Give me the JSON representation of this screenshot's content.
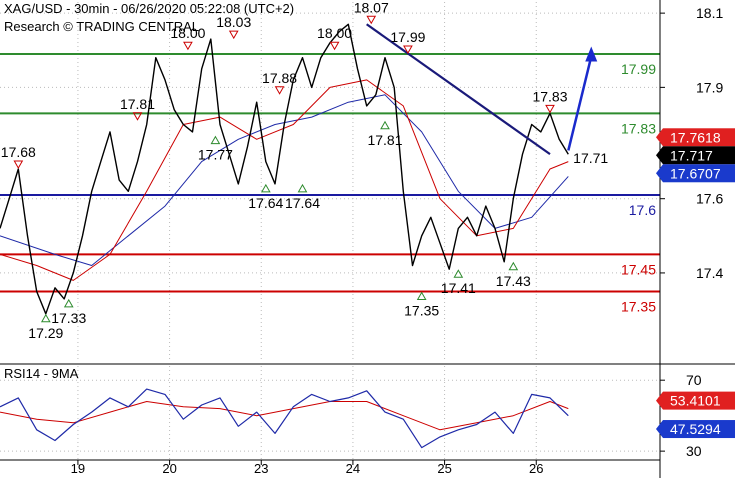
{
  "header": {
    "title": "XAG/USD - 30min - 06/26/2020 05:22:08 (UTC+2)",
    "subtitle": "Research © TRADING CENTRAL"
  },
  "colors": {
    "price": "#000000",
    "ma_fast": "#cc0000",
    "ma_slow": "#1f2aa8",
    "support_resistance_green": "#2e8b2e",
    "pivot_blue": "#1a1aa0",
    "support_red": "#cc0000",
    "trendline": "#1a1a7a",
    "arrow": "#1a2acc",
    "grid": "#bbbbbb",
    "badge_red": "#e02020",
    "badge_black": "#000000",
    "badge_blue": "#1a3acc"
  },
  "chart_data": [
    {
      "type": "line",
      "title": "XAG/USD - 30min - 06/26/2020 05:22:08 (UTC+2)",
      "ylim": [
        17.16,
        18.13
      ],
      "y_ticks": [
        "18.1",
        "17.9",
        "17.6",
        "17.4"
      ],
      "y_tick_values": [
        18.1,
        17.9,
        17.6,
        17.4
      ],
      "x_ticks": [
        "19",
        "20",
        "23",
        "24",
        "25",
        "26"
      ],
      "x_tick_positions": [
        8.5,
        18.5,
        28.5,
        38.5,
        48.5,
        58.5
      ],
      "x_range": [
        0,
        72
      ],
      "price_series": {
        "name": "",
        "x": [
          0,
          1,
          2,
          3,
          4,
          5,
          6,
          7,
          8,
          9,
          10,
          11,
          12,
          13,
          14,
          15,
          16,
          17,
          18,
          19,
          20,
          21,
          22,
          23,
          24,
          25,
          26,
          27,
          28,
          29,
          30,
          31,
          32,
          33,
          34,
          35,
          36,
          37,
          38,
          39,
          40,
          41,
          42,
          43,
          44,
          45,
          46,
          47,
          48,
          49,
          50,
          51,
          52,
          53,
          54,
          55,
          56,
          57,
          58,
          59,
          60,
          61,
          62
        ],
        "y": [
          17.52,
          17.6,
          17.68,
          17.5,
          17.35,
          17.29,
          17.36,
          17.33,
          17.4,
          17.5,
          17.62,
          17.7,
          17.78,
          17.65,
          17.62,
          17.7,
          17.8,
          17.98,
          17.92,
          17.84,
          17.8,
          17.78,
          17.95,
          18.03,
          17.8,
          17.72,
          17.64,
          17.74,
          17.86,
          17.7,
          17.64,
          17.8,
          17.92,
          17.98,
          17.9,
          17.98,
          18.02,
          18.05,
          18.07,
          17.95,
          17.85,
          17.88,
          17.98,
          17.9,
          17.62,
          17.42,
          17.5,
          17.55,
          17.48,
          17.41,
          17.52,
          17.55,
          17.5,
          17.58,
          17.52,
          17.43,
          17.6,
          17.72,
          17.8,
          17.78,
          17.83,
          17.76,
          17.72
        ]
      },
      "ma_fast_series": {
        "name": "",
        "x": [
          0,
          4,
          8,
          12,
          16,
          20,
          24,
          28,
          32,
          36,
          40,
          44,
          48,
          52,
          56,
          60,
          62
        ],
        "y": [
          17.45,
          17.42,
          17.38,
          17.45,
          17.62,
          17.8,
          17.82,
          17.76,
          17.8,
          17.9,
          17.92,
          17.85,
          17.6,
          17.5,
          17.52,
          17.68,
          17.7
        ]
      },
      "ma_slow_series": {
        "name": "",
        "x": [
          0,
          6,
          10,
          14,
          18,
          22,
          26,
          30,
          34,
          38,
          42,
          46,
          50,
          54,
          58,
          62
        ],
        "y": [
          17.5,
          17.45,
          17.42,
          17.5,
          17.58,
          17.7,
          17.76,
          17.8,
          17.82,
          17.86,
          17.88,
          17.78,
          17.62,
          17.52,
          17.55,
          17.66
        ]
      },
      "horizontal_levels": [
        {
          "label": "17.99",
          "value": 17.99,
          "color": "#2e8b2e"
        },
        {
          "label": "17.83",
          "value": 17.83,
          "color": "#2e8b2e"
        },
        {
          "label": "17.6",
          "value": 17.61,
          "color": "#1a1aa0"
        },
        {
          "label": "17.45",
          "value": 17.45,
          "color": "#cc0000"
        },
        {
          "label": "17.35",
          "value": 17.35,
          "color": "#cc0000"
        }
      ],
      "trendline": {
        "x1": 40,
        "y1": 18.07,
        "x2": 60,
        "y2": 17.72
      },
      "forecast_arrow": {
        "x1": 62,
        "y1": 17.73,
        "x2": 64.5,
        "y2": 18.01
      },
      "price_badges": [
        {
          "label": "17.7618",
          "value": 17.7618,
          "color": "#e02020"
        },
        {
          "label": "17.717",
          "value": 17.717,
          "color": "#000000"
        },
        {
          "label": "17.6707",
          "value": 17.6707,
          "color": "#1a3acc"
        }
      ],
      "annotations": [
        {
          "label": "17.68",
          "x": 2,
          "value": 17.68,
          "marker": "down"
        },
        {
          "label": "17.29",
          "x": 5,
          "value": 17.29,
          "marker": "up"
        },
        {
          "label": "17.33",
          "x": 7.5,
          "value": 17.33,
          "marker": "up"
        },
        {
          "label": "17.81",
          "x": 15,
          "value": 17.81,
          "marker": "down"
        },
        {
          "label": "18.00",
          "x": 20.5,
          "value": 18.0,
          "marker": "down"
        },
        {
          "label": "18.03",
          "x": 25.5,
          "value": 18.03,
          "marker": "down"
        },
        {
          "label": "17.77",
          "x": 23.5,
          "value": 17.77,
          "marker": "up"
        },
        {
          "label": "17.64",
          "x": 29,
          "value": 17.64,
          "marker": "up"
        },
        {
          "label": "17.64",
          "x": 33,
          "value": 17.64,
          "marker": "up"
        },
        {
          "label": "17.88",
          "x": 30.5,
          "value": 17.88,
          "marker": "down"
        },
        {
          "label": "18.00",
          "x": 36.5,
          "value": 18.0,
          "marker": "down"
        },
        {
          "label": "18.07",
          "x": 40.5,
          "value": 18.07,
          "marker": "down"
        },
        {
          "label": "17.99",
          "x": 44.5,
          "value": 17.99,
          "marker": "down"
        },
        {
          "label": "17.81",
          "x": 42,
          "value": 17.81,
          "marker": "up"
        },
        {
          "label": "17.35",
          "x": 46,
          "value": 17.35,
          "marker": "up"
        },
        {
          "label": "17.41",
          "x": 50,
          "value": 17.41,
          "marker": "up"
        },
        {
          "label": "17.43",
          "x": 56,
          "value": 17.43,
          "marker": "up"
        },
        {
          "label": "17.83",
          "x": 60,
          "value": 17.83,
          "marker": "down"
        },
        {
          "label": "17.71",
          "x": 61,
          "value": 17.71,
          "marker": "none"
        }
      ]
    },
    {
      "type": "line",
      "title": "RSI14 - 9MA",
      "ylim": [
        25,
        78
      ],
      "y_ticks": [
        "70",
        "30"
      ],
      "y_tick_values": [
        70,
        30
      ],
      "x_range": [
        0,
        72
      ],
      "rsi_series": {
        "name": "",
        "x": [
          0,
          2,
          4,
          6,
          8,
          10,
          12,
          14,
          16,
          18,
          20,
          22,
          24,
          26,
          28,
          30,
          32,
          34,
          36,
          38,
          40,
          42,
          44,
          46,
          48,
          50,
          52,
          54,
          56,
          58,
          60,
          62
        ],
        "y": [
          55,
          60,
          42,
          36,
          45,
          52,
          60,
          55,
          65,
          62,
          48,
          56,
          60,
          44,
          52,
          40,
          55,
          62,
          58,
          60,
          64,
          52,
          48,
          32,
          38,
          42,
          45,
          52,
          40,
          62,
          60,
          50
        ]
      },
      "rsi_ma_series": {
        "name": "",
        "x": [
          0,
          4,
          8,
          12,
          16,
          20,
          24,
          28,
          32,
          36,
          40,
          44,
          48,
          52,
          56,
          60,
          62
        ],
        "y": [
          52,
          48,
          46,
          52,
          58,
          55,
          54,
          50,
          54,
          58,
          58,
          50,
          42,
          46,
          50,
          58,
          54
        ]
      },
      "rsi_badges": [
        {
          "label": "53.4101",
          "value": 53.4101,
          "color": "#e02020"
        },
        {
          "label": "47.5294",
          "value": 47.5294,
          "color": "#1a3acc"
        }
      ]
    }
  ]
}
